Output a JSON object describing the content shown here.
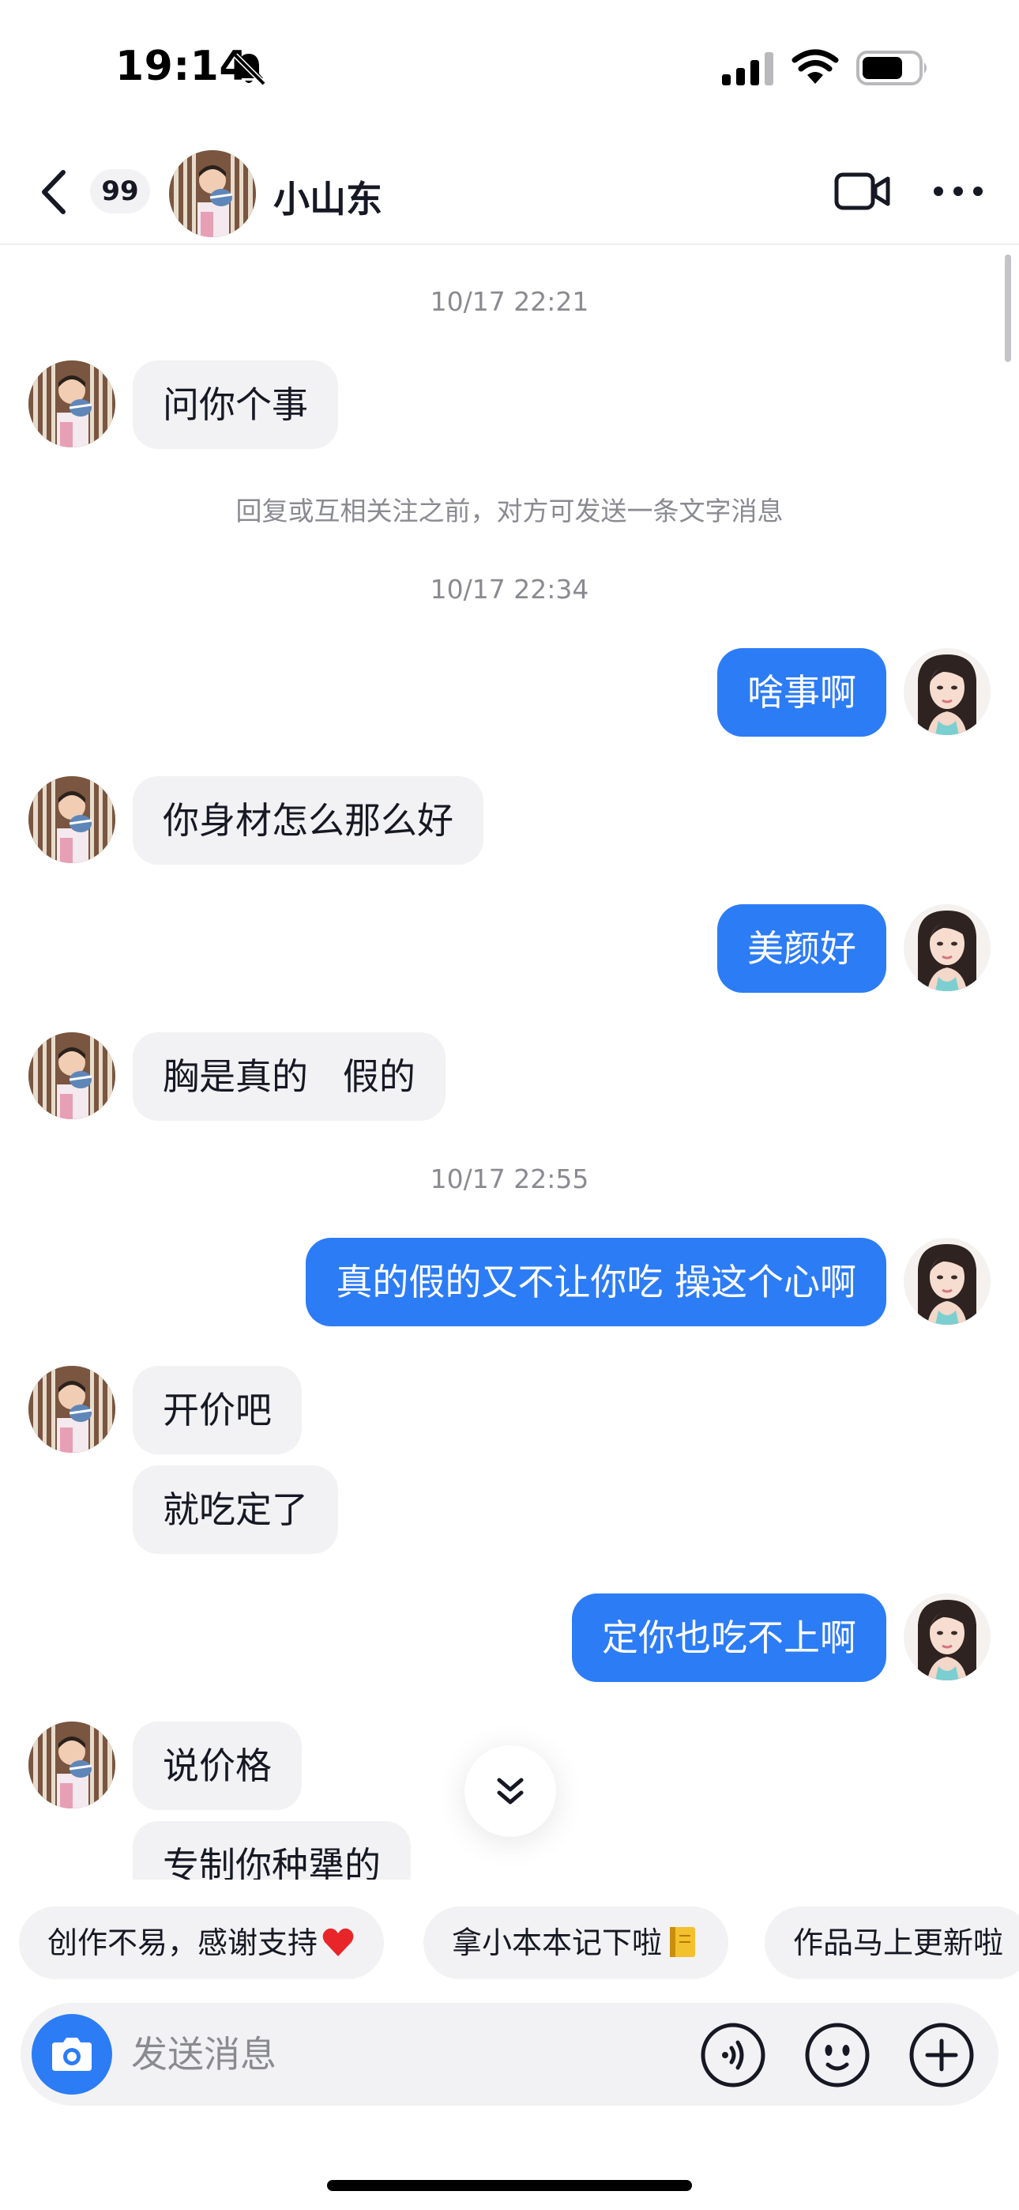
{
  "status_bar": {
    "time": "19:14",
    "icons": [
      "bell-slash-icon",
      "signal-icon",
      "wifi-icon",
      "battery-icon"
    ]
  },
  "header": {
    "back_icon": "chevron-left-icon",
    "unread_count": "99",
    "contact_name": "小山东",
    "video_call_icon": "video-camera-icon",
    "more_icon": "ellipsis-icon"
  },
  "messages": [
    {
      "type": "timestamp",
      "text": "10/17 22:21"
    },
    {
      "type": "incoming",
      "text": "问你个事"
    },
    {
      "type": "system",
      "text": "回复或互相关注之前，对方可发送一条文字消息"
    },
    {
      "type": "timestamp",
      "text": "10/17 22:34"
    },
    {
      "type": "outgoing",
      "text": "啥事啊"
    },
    {
      "type": "incoming",
      "text": "你身材怎么那么好"
    },
    {
      "type": "outgoing",
      "text": "美颜好"
    },
    {
      "type": "incoming",
      "text": "胸是真的   假的"
    },
    {
      "type": "timestamp",
      "text": "10/17 22:55"
    },
    {
      "type": "outgoing",
      "text": "真的假的又不让你吃 操这个心啊"
    },
    {
      "type": "incoming",
      "text": "开价吧"
    },
    {
      "type": "incoming",
      "text": "就吃定了"
    },
    {
      "type": "outgoing",
      "text": "定你也吃不上啊"
    },
    {
      "type": "incoming",
      "text": "说价格"
    },
    {
      "type": "incoming",
      "text": "专制你种犟的"
    }
  ],
  "quick_replies": [
    {
      "label": "创作不易，感谢支持",
      "emoji_icon": "red-heart-icon"
    },
    {
      "label": "拿小本本记下啦",
      "emoji_icon": "notebook-icon"
    },
    {
      "label": "作品马上更新啦",
      "emoji_icon": ""
    }
  ],
  "input_bar": {
    "placeholder": "发送消息",
    "camera_icon": "camera-icon",
    "voice_icon": "voice-icon",
    "emoji_icon": "smiley-face-icon",
    "plus_icon": "plus-circle-icon"
  },
  "colors": {
    "accent_blue": "#2C7CF6",
    "bubble_gray": "#F2F2F4",
    "meta_text": "#8A8B91",
    "heart_red": "#E8262A",
    "notebook_yellow": "#F4C12E"
  }
}
